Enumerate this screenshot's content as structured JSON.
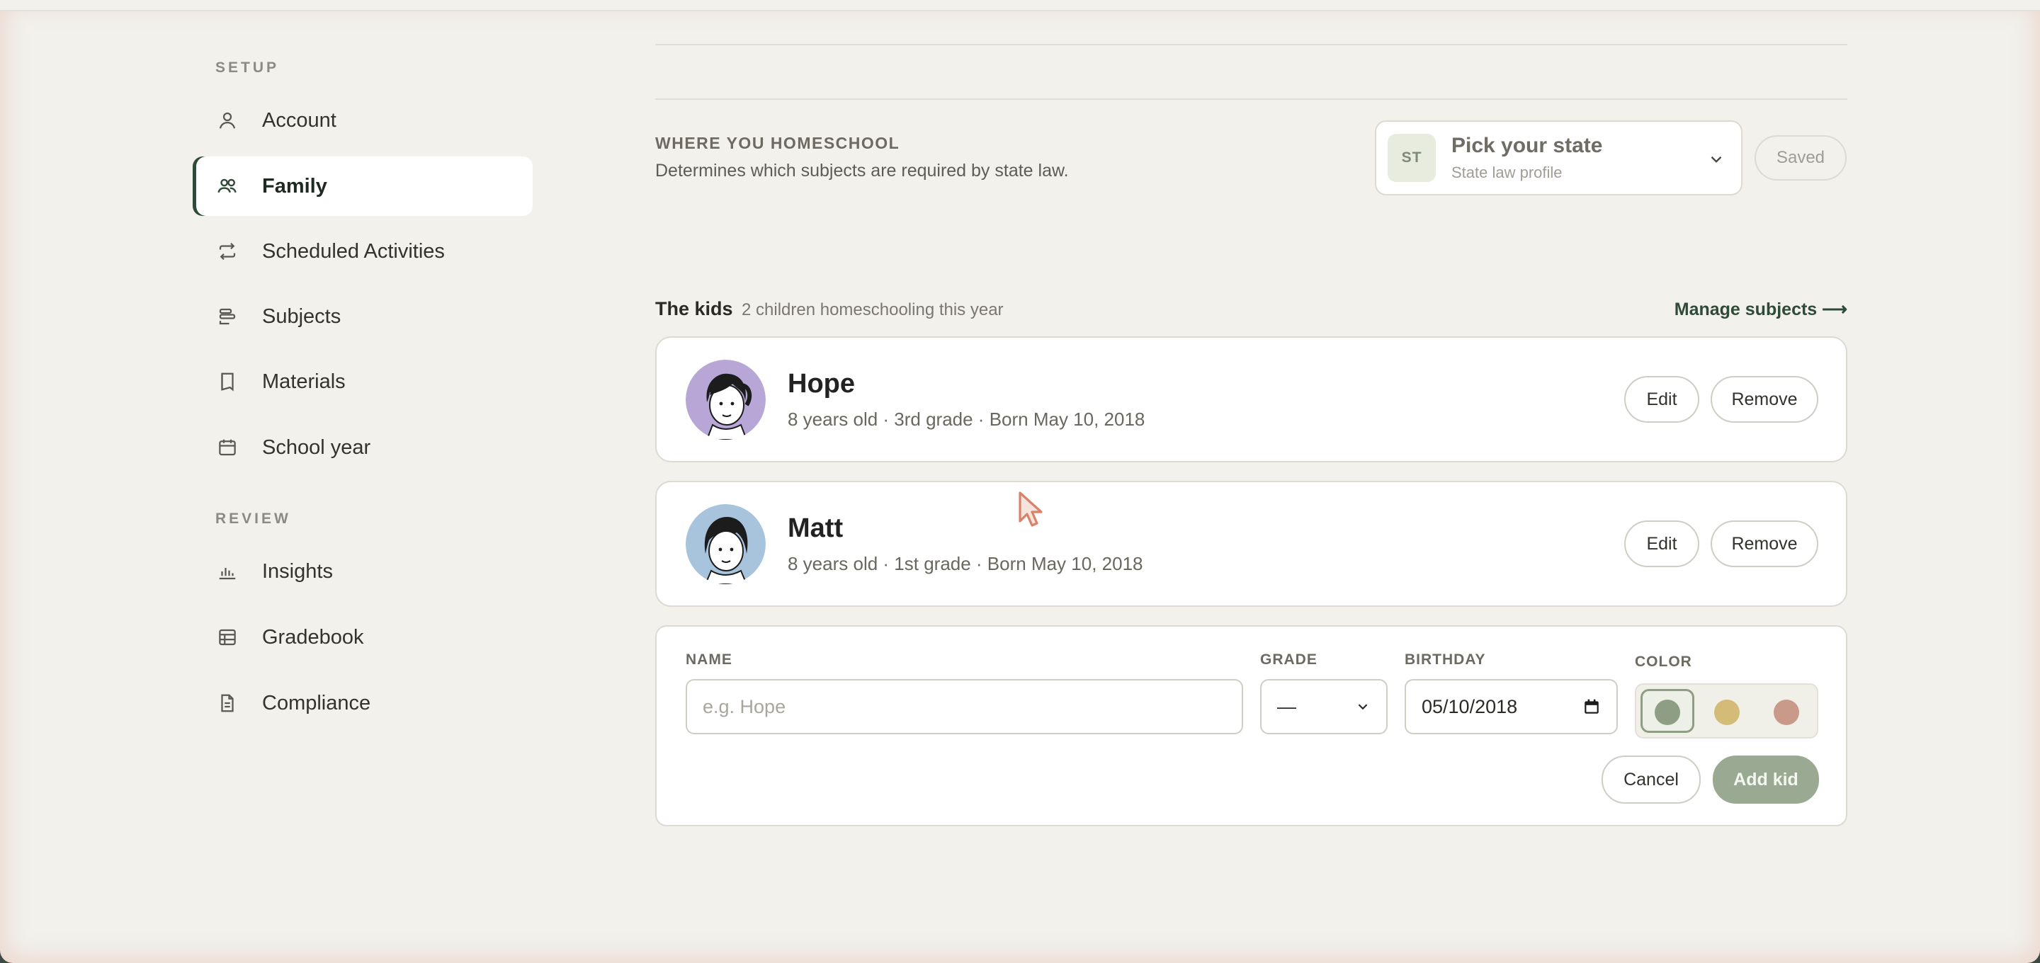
{
  "sidebar": {
    "setup_label": "SETUP",
    "review_label": "REVIEW",
    "setup_items": [
      {
        "label": "Account",
        "icon": "user-icon"
      },
      {
        "label": "Family",
        "icon": "users-icon"
      },
      {
        "label": "Scheduled Activities",
        "icon": "repeat-icon"
      },
      {
        "label": "Subjects",
        "icon": "subjects-icon"
      },
      {
        "label": "Materials",
        "icon": "bookmark-icon"
      },
      {
        "label": "School year",
        "icon": "calendar-icon"
      }
    ],
    "review_items": [
      {
        "label": "Insights",
        "icon": "bar-chart-icon"
      },
      {
        "label": "Gradebook",
        "icon": "table-icon"
      },
      {
        "label": "Compliance",
        "icon": "document-icon"
      }
    ],
    "active": "Family"
  },
  "where": {
    "title": "WHERE YOU HOMESCHOOL",
    "subtitle": "Determines which subjects are required by state law.",
    "picker_badge": "ST",
    "picker_title": "Pick your state",
    "picker_sub": "State law profile",
    "saved_label": "Saved"
  },
  "kids": {
    "title": "The kids",
    "count_text": "2 children homeschooling this year",
    "manage_link": "Manage subjects ⟶",
    "list": [
      {
        "name": "Hope",
        "meta": "8 years old · 3rd grade · Born May 10, 2018",
        "avatar_color": "#b7a6d6"
      },
      {
        "name": "Matt",
        "meta": "8 years old · 1st grade · Born May 10, 2018",
        "avatar_color": "#a8c3dc"
      }
    ],
    "edit_label": "Edit",
    "remove_label": "Remove"
  },
  "form": {
    "name_label": "NAME",
    "name_placeholder": "e.g. Hope",
    "grade_label": "GRADE",
    "grade_value": "—",
    "birthday_label": "BIRTHDAY",
    "birthday_value": "05/10/2018",
    "color_label": "COLOR",
    "colors": [
      "#8e9e84",
      "#d4bb78",
      "#c99a8a"
    ],
    "cancel_label": "Cancel",
    "add_label": "Add kid"
  },
  "colors": {
    "accent": "#2f4a36",
    "add_button": "#9aaa92"
  }
}
